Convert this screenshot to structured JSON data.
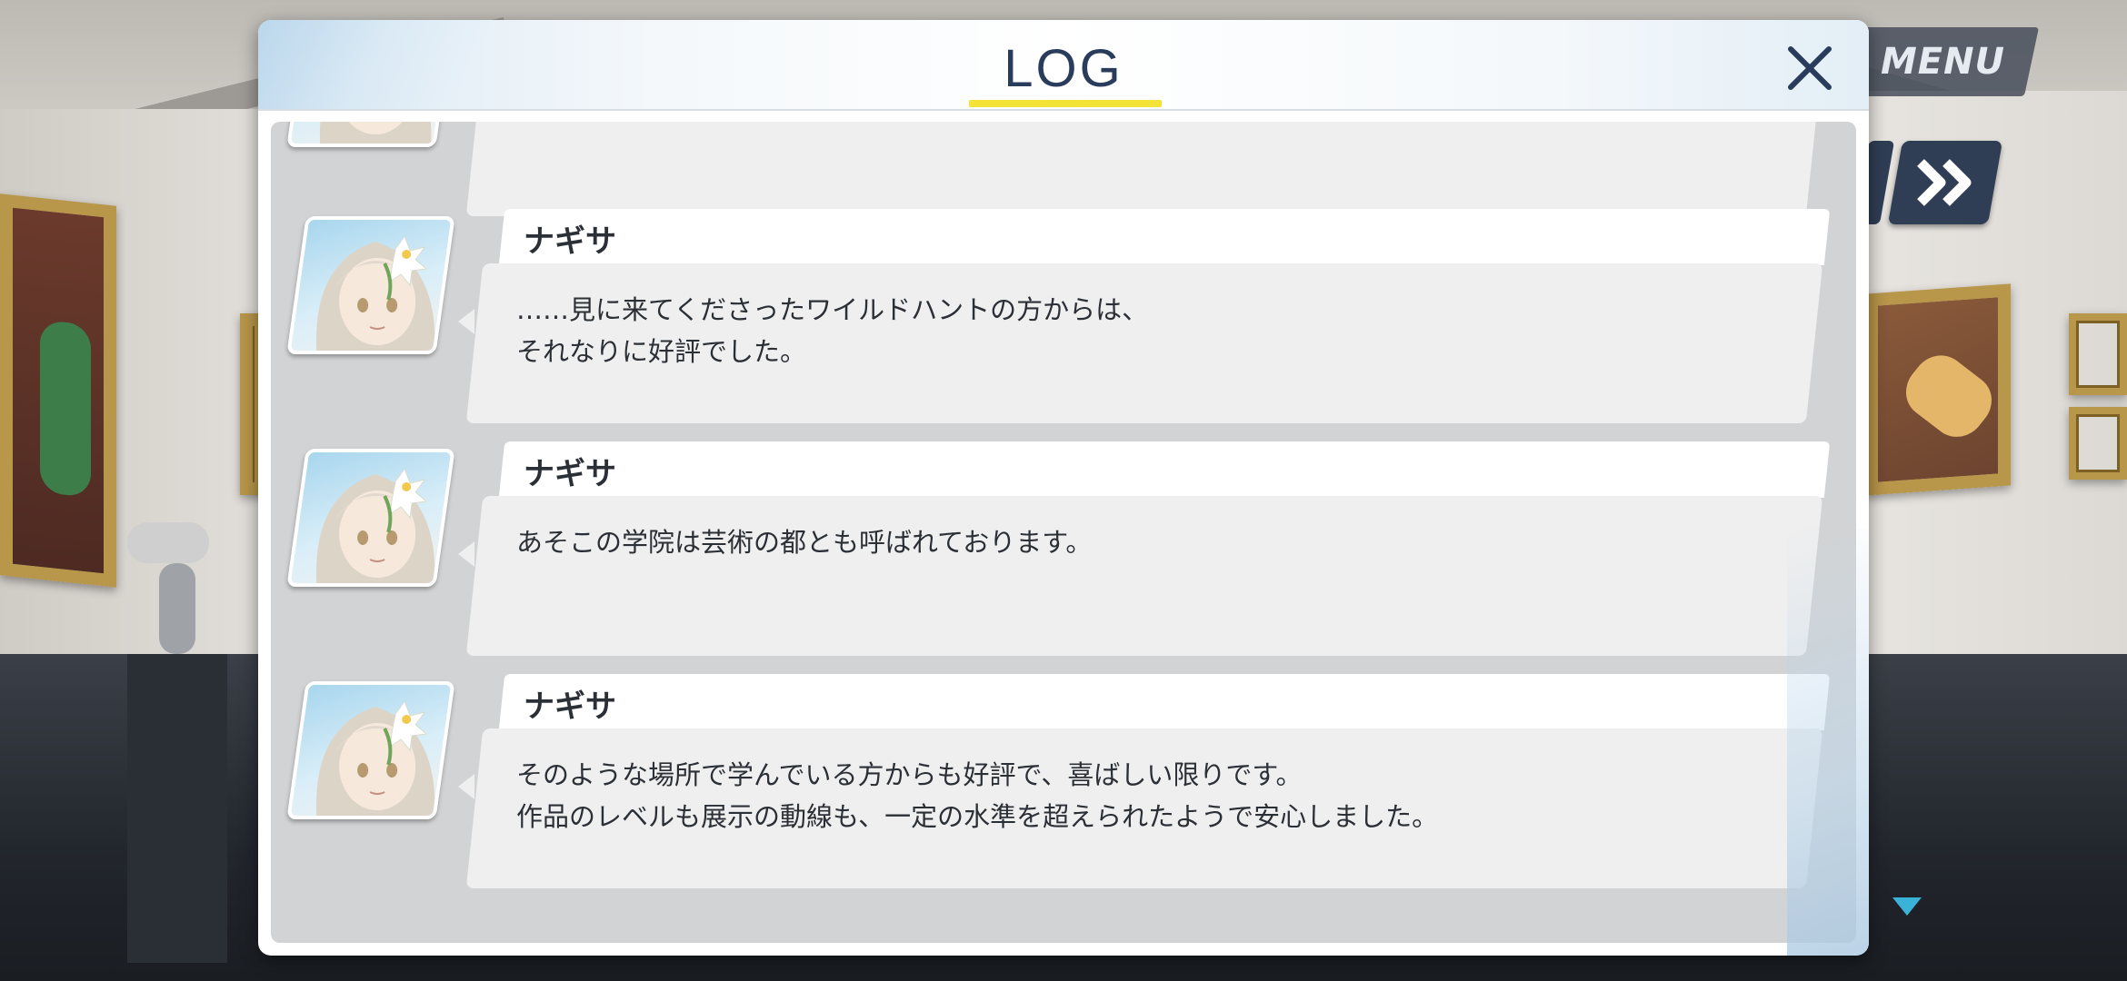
{
  "hud": {
    "menu_label": "MENU",
    "fast_forward_icon": "double-chevron-right-icon",
    "next_indicator_icon": "triangle-down-icon"
  },
  "log": {
    "title": "LOG",
    "close_icon": "close-icon",
    "entries": [
      {
        "speaker": "",
        "text": ""
      },
      {
        "speaker": "ナギサ",
        "text": "……見に来てくださったワイルドハントの方からは、\nそれなりに好評でした。"
      },
      {
        "speaker": "ナギサ",
        "text": "あそこの学院は芸術の都とも呼ばれております。"
      },
      {
        "speaker": "ナギサ",
        "text": "そのような場所で学んでいる方からも好評で、喜ばしい限りです。\n作品のレベルも展示の動線も、一定の水準を超えられたようで安心しました。"
      }
    ]
  },
  "colors": {
    "title_text": "#2a3c5c",
    "title_underline": "#f3e338",
    "bubble_bg": "#efefef",
    "panel_body_bg": "#d2d3d4",
    "fast_forward_bg": "#2f3d55",
    "indicator": "#3bb3d8"
  }
}
